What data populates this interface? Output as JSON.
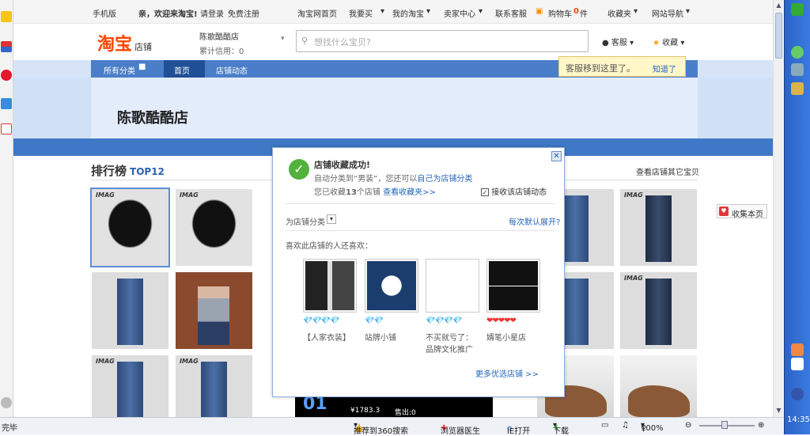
{
  "topbar": {
    "mobile": "手机版",
    "welcome": "亲，欢迎来淘宝!",
    "login": "请登录",
    "register": "免费注册",
    "home": "淘宝网首页",
    "buy": "我要买",
    "my_taobao": "我的淘宝",
    "seller": "卖家中心",
    "contact": "联系客服",
    "cart": "购物车",
    "cart_count": "0",
    "cart_unit": "件",
    "favorites": "收藏夹",
    "sitenav": "网站导航"
  },
  "header": {
    "logo": "淘宝",
    "logo_sub": "店铺",
    "shop_name": "陈歌酷酷店",
    "credit": "累计信用：0",
    "search_placeholder": "想找什么宝贝?",
    "kefu": "客服",
    "fav": "收藏",
    "tip_text": "客服移到这里了。",
    "tip_link": "知道了"
  },
  "nav": {
    "all": "所有分类",
    "home": "首页",
    "news": "店铺动态"
  },
  "banner": {
    "title": "陈歌酷酷店"
  },
  "rank": {
    "title": "排行榜",
    "sub": "TOP12",
    "other": "查看店铺其它宝贝"
  },
  "products": [
    {
      "brand": "IMAG"
    },
    {
      "brand": "IMAG"
    },
    {
      "brand": ""
    },
    {
      "brand": "IMAG"
    },
    {
      "brand": ""
    },
    {
      "brand": ""
    },
    {
      "brand": ""
    },
    {
      "brand": "IMAG"
    },
    {
      "brand": "IMAG"
    },
    {
      "brand": "IMAG"
    },
    {
      "brand": ""
    },
    {
      "brand": ""
    }
  ],
  "price_block": {
    "rank": "01",
    "price": "¥1783.3",
    "sold": "售出:0"
  },
  "collect_page": "收集本页",
  "dialog": {
    "title": "店铺收藏成功!",
    "line1_a": "自动分类到",
    "line1_cat": "“男装”",
    "line1_b": "，您还可以",
    "line1_link": "自己为店铺分类",
    "line2_a": "您已收藏",
    "line2_count": "13",
    "line2_b": "个店铺",
    "line2_link": "查看收藏夹>>",
    "subscribe": "接收该店铺动态",
    "category_label": "为店铺分类",
    "default_expand": "每次默认展开?",
    "also_like": "喜欢此店铺的人还喜欢：",
    "more": "更多优选店铺 >>",
    "suggestions": [
      {
        "name": "【人家衣装】",
        "rating": "💎💎💎💎"
      },
      {
        "name": "站牌小铺",
        "rating": "💎💎"
      },
      {
        "name": "不买就亏了：",
        "name2": "品牌文化推广",
        "rating": "💎💎💎💎"
      },
      {
        "name": "婿笔小星店",
        "rating": "❤❤❤❤❤"
      }
    ]
  },
  "statusbar": {
    "left": "完毕",
    "recommend": "推荐到360搜索",
    "doctor": "浏览器医生",
    "ie": "IE打开",
    "download": "下载",
    "zoom": "100%"
  },
  "taskbar": {
    "time": "14:35"
  },
  "colors": {
    "taobao_orange": "#ff4400",
    "nav_blue": "#4a7ec8",
    "link_blue": "#2266bb"
  }
}
